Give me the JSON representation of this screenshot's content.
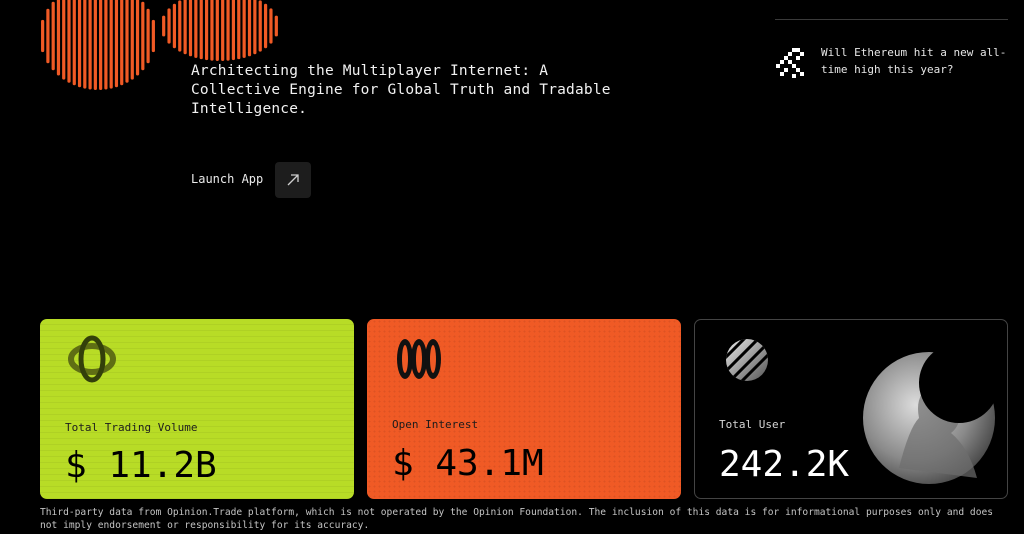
{
  "hero": {
    "title": "Architecting the Multiplayer Internet: A Collective Engine for Global Truth and Tradable Intelligence.",
    "launch_label": "Launch App",
    "launch_icon": "arrow-up-right-icon"
  },
  "promo": {
    "text": "Will Ethereum hit a new all-time high this year?",
    "icon": "pixel-arrow-icon"
  },
  "stats": [
    {
      "label": "Total Trading Volume",
      "value": "$ 11.2B",
      "color": "#b8dc26",
      "icon": "orbit-ring-icon"
    },
    {
      "label": "Open Interest",
      "value": "$ 43.1M",
      "color": "#f05a25",
      "icon": "triple-pill-icon"
    },
    {
      "label": "Total User",
      "value": "242.2K",
      "color": "#000000",
      "icon": "striped-sphere-icon"
    }
  ],
  "disclaimer": "Third-party data from Opinion.Trade platform, which is not operated by the Opinion Foundation. The inclusion of this data is for informational purposes only and does not imply endorsement or responsibility for its accuracy.",
  "colors": {
    "background": "#000000",
    "accent_orange": "#f05a25",
    "accent_lime": "#b8dc26"
  }
}
